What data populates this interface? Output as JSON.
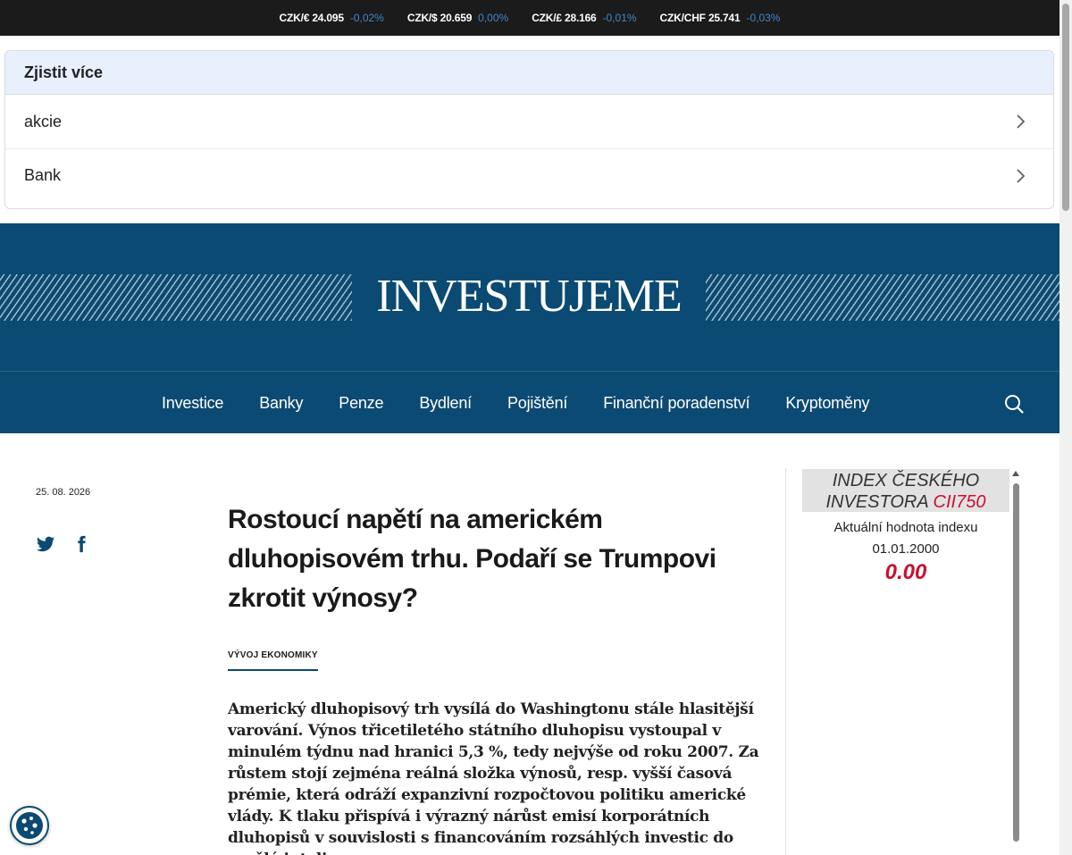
{
  "ticker": [
    {
      "pair": "CZK/€ 24.095",
      "change": "-0,02%"
    },
    {
      "pair": "CZK/$ 20.659",
      "change": "0,00%"
    },
    {
      "pair": "CZK/£ 28.166",
      "change": "-0,01%"
    },
    {
      "pair": "CZK/CHF 25.741",
      "change": "-0,03%"
    }
  ],
  "learn_more": {
    "title": "Zjistit více",
    "items": [
      "akcie",
      "Bank"
    ]
  },
  "masthead": {
    "logo": "INVESTUJEME"
  },
  "nav": {
    "items": [
      "Investice",
      "Banky",
      "Penze",
      "Bydlení",
      "Pojištění",
      "Finanční poradenství",
      "Kryptoměny"
    ]
  },
  "article": {
    "date": "25. 08. 2026",
    "title": "Rostoucí napětí na americkém dluhopisovém trhu. Podaří se Trumpovi zkrotit výnosy?",
    "category": "VÝVOJ EKONOMIKY",
    "lead": "Americký dluhopisový trh vysílá do Washingtonu stále hlasitější varování. Výnos třicetiletého státního dluhopisu vystoupal v minulém týdnu nad hranici 5,3 %, tedy nejvýše od roku 2007. Za růstem stojí zejména reálná složka výnosů, resp. vyšší časová prémie, která odráží expanzivní rozpočtovou politiku americké vlády. K tlaku přispívá i výrazný nárůst emisí korporátních dluhopisů v souvislosti s financováním rozsáhlých investic do umělé inteligence."
  },
  "widget": {
    "title_line1": "INDEX ČESKÉHO",
    "title_line2": "INVESTORA",
    "code": "CII750",
    "label": "Aktuální hodnota indexu",
    "date": "01.01.2000",
    "value": "0.00"
  },
  "colors": {
    "brand": "#0b4a72",
    "accent": "#c8102e",
    "ticker_change": "#3f87c9"
  },
  "icons": [
    "chevron-right-icon",
    "search-icon",
    "twitter-icon",
    "facebook-icon",
    "cookie-icon"
  ]
}
